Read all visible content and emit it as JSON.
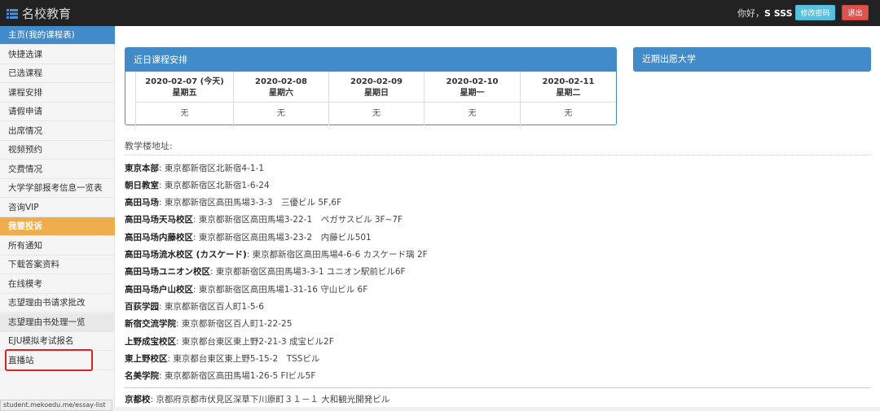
{
  "header": {
    "brand": "名校教育",
    "greeting": "你好，",
    "username": "S SSS",
    "change_password": "修改密码",
    "logout": "退出"
  },
  "sidebar": {
    "items": [
      {
        "label": "主页(我的课程表)",
        "state": "active"
      },
      {
        "label": "快捷选课"
      },
      {
        "label": "已选课程"
      },
      {
        "label": "课程安排"
      },
      {
        "label": "请假申请"
      },
      {
        "label": "出席情况"
      },
      {
        "label": "视频预约"
      },
      {
        "label": "交费情况"
      },
      {
        "label": "大学学部报考信息一览表"
      },
      {
        "label": "咨询VIP"
      },
      {
        "label": "我要投诉",
        "state": "highlight"
      },
      {
        "label": "所有通知"
      },
      {
        "label": "下载答案资料"
      },
      {
        "label": "在线模考"
      },
      {
        "label": "志望理由书请求批改"
      },
      {
        "label": "志望理由书处理一览",
        "state": "hover"
      },
      {
        "label": "EJU模拟考试报名"
      },
      {
        "label": "直播站"
      }
    ]
  },
  "status_url": "student.mekoedu.me/essay-list",
  "schedule": {
    "title": "近日课程安排",
    "days": [
      {
        "date": "2020-02-07 (今天)",
        "weekday": "星期五",
        "value": "无"
      },
      {
        "date": "2020-02-08",
        "weekday": "星期六",
        "value": "无"
      },
      {
        "date": "2020-02-09",
        "weekday": "星期日",
        "value": "无"
      },
      {
        "date": "2020-02-10",
        "weekday": "星期一",
        "value": "无"
      },
      {
        "date": "2020-02-11",
        "weekday": "星期二",
        "value": "无"
      }
    ]
  },
  "near_univ": {
    "title": "近期出愿大学"
  },
  "addresses": {
    "label": "教学楼地址:",
    "items": [
      {
        "name": "東京本部",
        "addr": "東京都新宿区北新宿4-1-1"
      },
      {
        "name": "朝日教室",
        "addr": "東京都新宿区北新宿1-6-24"
      },
      {
        "name": "高田马场",
        "addr": "東京都新宿区高田馬場3-3-3　三優ビル 5F,6F"
      },
      {
        "name": "高田马场天马校区",
        "addr": "東京都新宿区高田馬場3-22-1　ペガサスビル 3F~7F"
      },
      {
        "name": "高田马场内藤校区",
        "addr": "東京都新宿区高田馬場3-23-2　内藤ビル501"
      },
      {
        "name": "高田马场流水校区 (カスケード)",
        "addr": "東京都新宿区高田馬場4-6-6 カスケード璃 2F"
      },
      {
        "name": "高田马场ユニオン校区",
        "addr": "東京都新宿区高田馬場3-3-1 ユニオン駅前ビル6F"
      },
      {
        "name": "高田马场户山校区",
        "addr": "東京都新宿区高田馬場1-31-16 守山ビル 6F"
      },
      {
        "name": "百荻学园",
        "addr": "東京都新宿区百人町1-5-6"
      },
      {
        "name": "新宿交流学院",
        "addr": "東京都新宿区百人町1-22-25"
      },
      {
        "name": "上野成宝校区",
        "addr": "東京都台東区東上野2-21-3 成宝ビル2F"
      },
      {
        "name": "東上野校区",
        "addr": "東京都台東区東上野5-15-2　TSSビル"
      },
      {
        "name": "名美学院",
        "addr": "東京都新宿区高田馬場1-26-5 FIビル5F"
      }
    ],
    "kyoto": {
      "name": "京都校",
      "addr": "京都府京都市伏見区深草下川原町３１－１ 大和観光開発ビル"
    }
  }
}
